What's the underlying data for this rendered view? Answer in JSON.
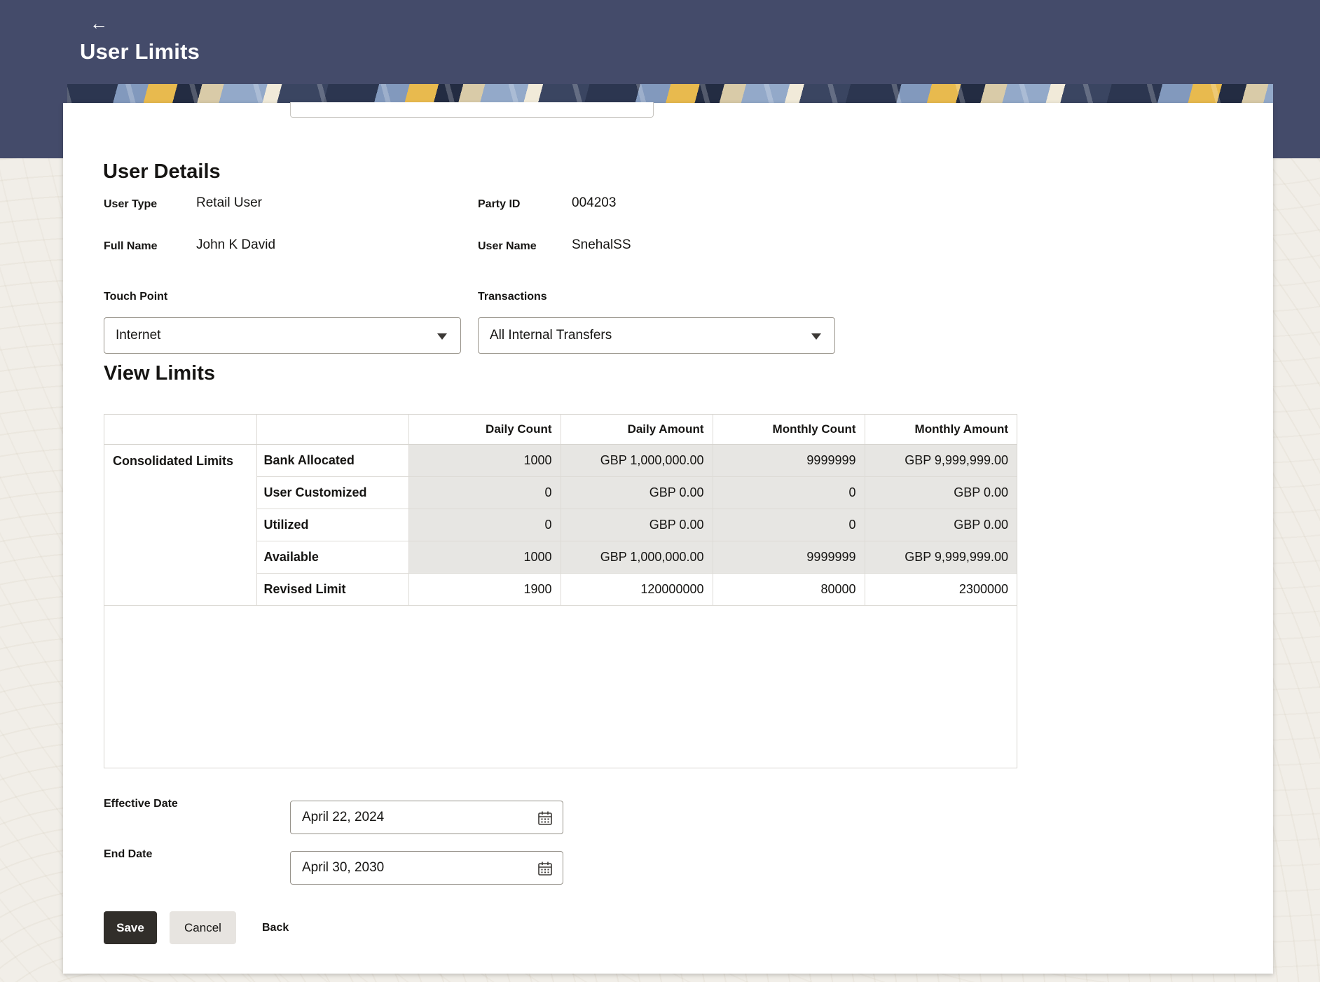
{
  "header": {
    "title": "User Limits"
  },
  "icons": {
    "back": "arrow-left",
    "select_caret": "chevron-down",
    "date_picker": "calendar"
  },
  "user_details": {
    "section_title": "User Details",
    "fields": [
      {
        "label": "User Type",
        "value": "Retail User"
      },
      {
        "label": "Party ID",
        "value": "004203"
      },
      {
        "label": "Full Name",
        "value": "John K David"
      },
      {
        "label": "User Name",
        "value": "SnehalSS"
      }
    ],
    "touch_point": {
      "label": "Touch Point",
      "value": "Internet"
    },
    "transactions": {
      "label": "Transactions",
      "value": "All Internal Transfers"
    }
  },
  "view_limits": {
    "section_title": "View Limits",
    "table": {
      "columns": [
        "",
        "",
        "Daily Count",
        "Daily Amount",
        "Monthly Count",
        "Monthly Amount"
      ],
      "group_label": "Consolidated Limits",
      "rows": [
        {
          "label": "Bank Allocated",
          "values": [
            "1000",
            "GBP 1,000,000.00",
            "9999999",
            "GBP 9,999,999.00"
          ],
          "readonly": true
        },
        {
          "label": "User Customized",
          "values": [
            "0",
            "GBP 0.00",
            "0",
            "GBP 0.00"
          ],
          "readonly": true
        },
        {
          "label": "Utilized",
          "values": [
            "0",
            "GBP 0.00",
            "0",
            "GBP 0.00"
          ],
          "readonly": true
        },
        {
          "label": "Available",
          "values": [
            "1000",
            "GBP 1,000,000.00",
            "9999999",
            "GBP 9,999,999.00"
          ],
          "readonly": true
        },
        {
          "label": "Revised Limit",
          "values": [
            "1900",
            "120000000",
            "80000",
            "2300000"
          ],
          "readonly": false
        }
      ]
    }
  },
  "dates": {
    "effective": {
      "label": "Effective Date",
      "value": "April 22, 2024"
    },
    "end": {
      "label": "End Date",
      "value": "April 30, 2030"
    }
  },
  "actions": {
    "save": "Save",
    "cancel": "Cancel",
    "back": "Back"
  },
  "colors": {
    "header_bg": "#444B6A",
    "page_bg": "#F1EEE8",
    "readonly_cell_bg": "#E7E6E3",
    "save_button_bg": "#312E2A",
    "cancel_button_bg": "#E7E4E0",
    "text": "#161513",
    "banner_palette": [
      "#2C3650",
      "#8299BD",
      "#E8BA4E",
      "#232C42",
      "#D9CBA8",
      "#93A9C9",
      "#F1EAD9",
      "#3A4561"
    ]
  }
}
